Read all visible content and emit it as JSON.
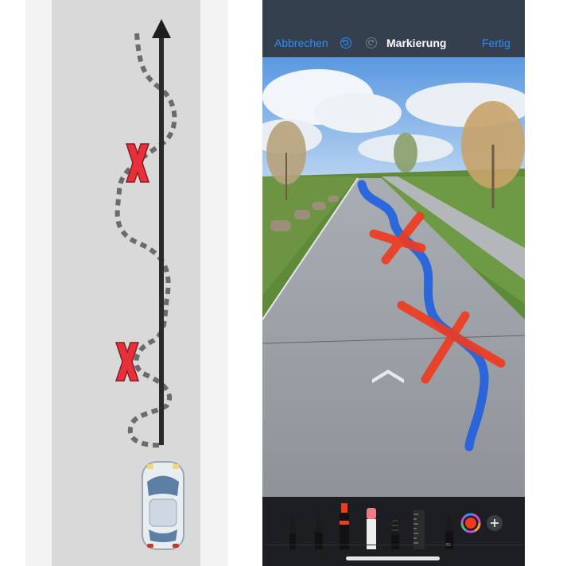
{
  "header": {
    "cancel_label": "Abbrechen",
    "title": "Markierung",
    "done_label": "Fertig"
  },
  "icons": [
    "undo-icon",
    "redo-icon",
    "pen-icon",
    "marker-icon",
    "highlighter-icon",
    "eraser-icon",
    "lasso-icon",
    "ruler-icon",
    "pencil-icon",
    "color-picker-icon",
    "add-icon",
    "car-icon",
    "arrow-up-icon"
  ],
  "colors": {
    "accent": "#2f8cff",
    "path_line": "#2a2a2a",
    "dotted_path": "#6b6b6b",
    "cross_red": "#e8303a",
    "blue_stroke": "#1f5fe0",
    "red_stroke": "#f03a1e"
  },
  "toolbar": {
    "tools": [
      "pen",
      "marker",
      "highlighter",
      "eraser",
      "lasso",
      "ruler",
      "pencil"
    ]
  }
}
